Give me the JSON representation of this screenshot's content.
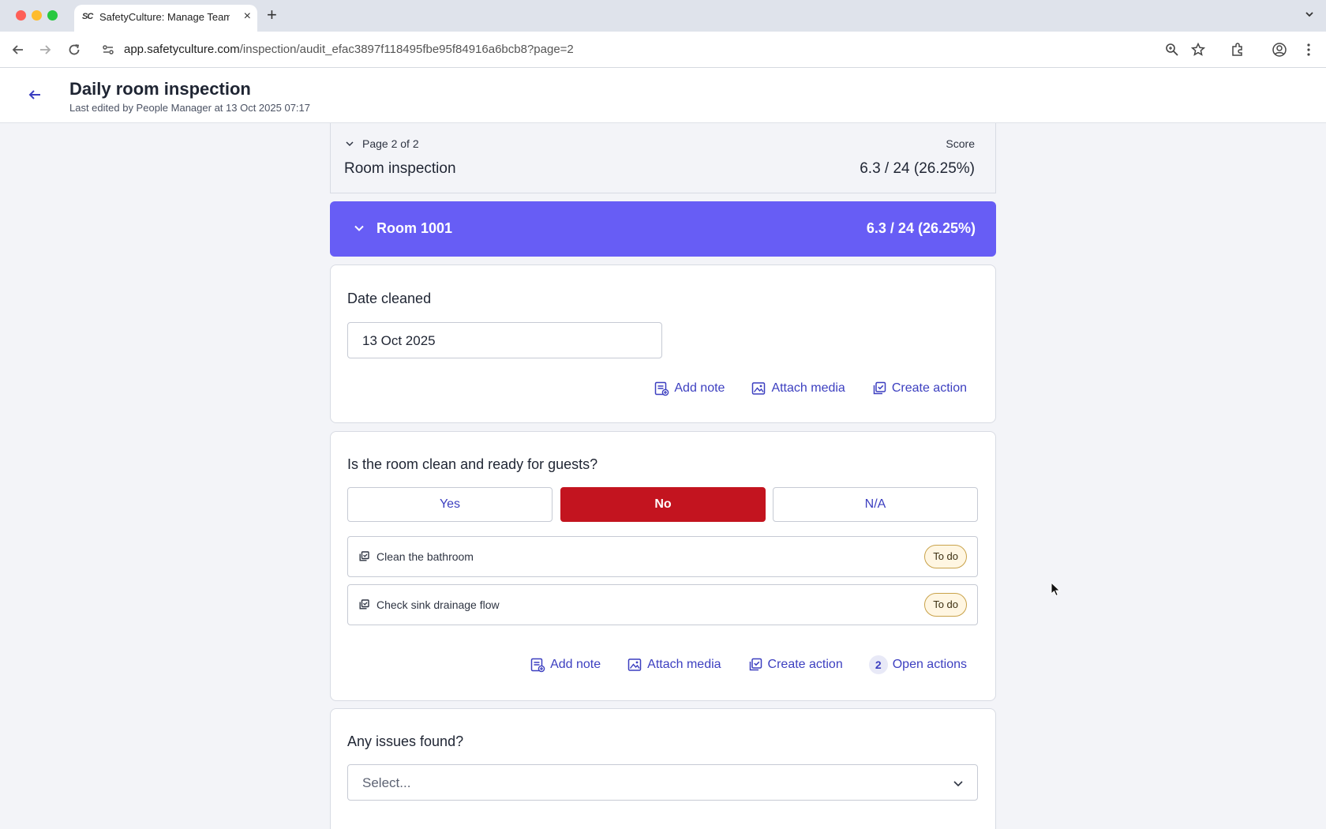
{
  "browser": {
    "tab_title": "SafetyCulture: Manage Teams",
    "tab_favicon": "SC",
    "url_host": "app.safetyculture.com",
    "url_path": "/inspection/audit_efac3897f118495fbe95f84916a6bcb8?page=2"
  },
  "header": {
    "title": "Daily room inspection",
    "subtitle": "Last edited by People Manager at 13 Oct 2025 07:17"
  },
  "page_header": {
    "page_indicator": "Page 2 of 2",
    "score_label": "Score",
    "section_title": "Room inspection",
    "score_value": "6.3 / 24 (26.25%)"
  },
  "room_section": {
    "title": "Room 1001",
    "score": "6.3 / 24 (26.25%)",
    "color": "#675df5"
  },
  "date_question": {
    "label": "Date cleaned",
    "value": "13 Oct 2025",
    "actions": {
      "add_note": "Add note",
      "attach_media": "Attach media",
      "create_action": "Create action"
    }
  },
  "ready_question": {
    "label": "Is the room clean and ready for guests?",
    "options": [
      "Yes",
      "No",
      "N/A"
    ],
    "selected": "No",
    "selected_color": "#c3141f",
    "action_items": [
      {
        "title": "Clean the bathroom",
        "status": "To do"
      },
      {
        "title": "Check sink drainage flow",
        "status": "To do"
      }
    ],
    "actions": {
      "add_note": "Add note",
      "attach_media": "Attach media",
      "create_action": "Create action",
      "open_actions_count": "2",
      "open_actions": "Open actions"
    }
  },
  "issues_question": {
    "label": "Any issues found?",
    "placeholder": "Select..."
  }
}
